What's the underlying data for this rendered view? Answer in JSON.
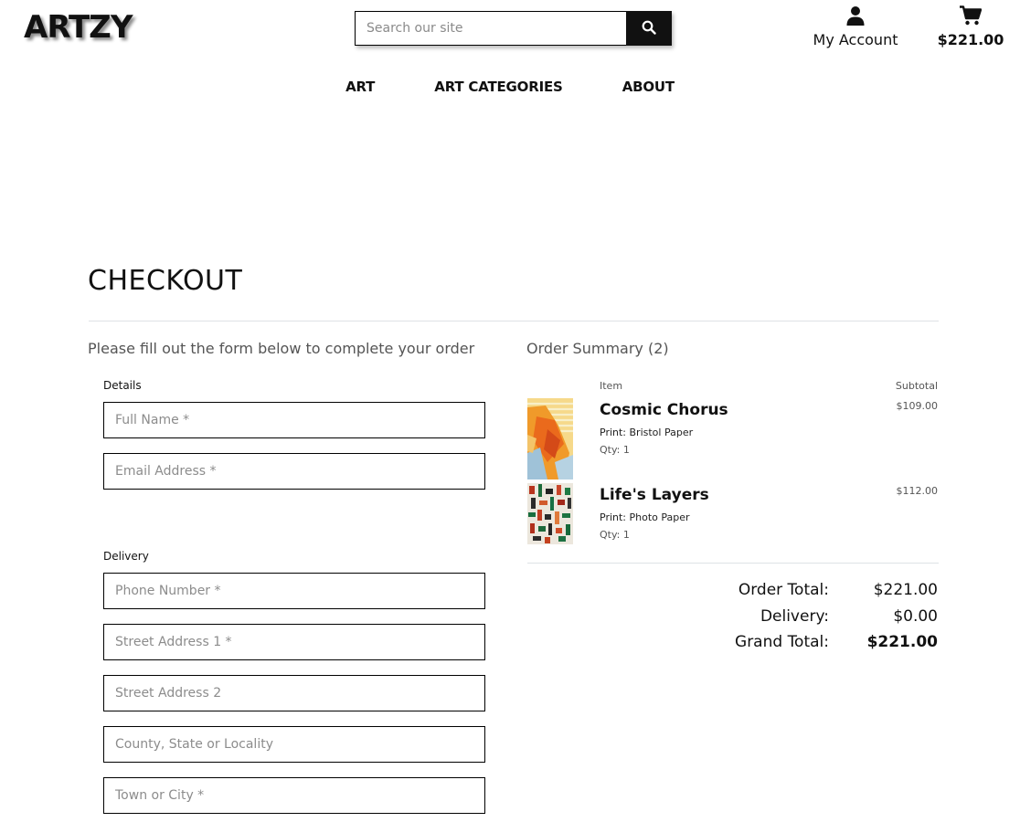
{
  "header": {
    "logo": "ARTZY",
    "search_placeholder": "Search our site",
    "account_label": "My Account",
    "cart_total": "$221.00"
  },
  "nav": {
    "items": [
      {
        "label": "ART"
      },
      {
        "label": "ART CATEGORIES"
      },
      {
        "label": "ABOUT"
      }
    ]
  },
  "page": {
    "title": "CHECKOUT",
    "form_intro": "Please fill out the form below to complete your order"
  },
  "form": {
    "details_label": "Details",
    "full_name_placeholder": "Full Name *",
    "email_placeholder": "Email Address *",
    "delivery_label": "Delivery",
    "phone_placeholder": "Phone Number *",
    "street1_placeholder": "Street Address 1 *",
    "street2_placeholder": "Street Address 2",
    "county_placeholder": "County, State or Locality",
    "town_placeholder": "Town or City *"
  },
  "summary": {
    "title": "Order Summary (2)",
    "col_item": "Item",
    "col_subtotal": "Subtotal",
    "items": [
      {
        "name": "Cosmic Chorus",
        "print": "Print: Bristol Paper",
        "qty": "Qty: 1",
        "subtotal": "$109.00"
      },
      {
        "name": "Life's Layers",
        "print": "Print: Photo Paper",
        "qty": "Qty: 1",
        "subtotal": "$112.00"
      }
    ],
    "order_total_label": "Order Total:",
    "order_total": "$221.00",
    "delivery_label": "Delivery:",
    "delivery": "$0.00",
    "grand_total_label": "Grand Total:",
    "grand_total": "$221.00"
  },
  "icons": {
    "search": "search-icon",
    "account": "user-icon",
    "cart": "cart-icon"
  }
}
